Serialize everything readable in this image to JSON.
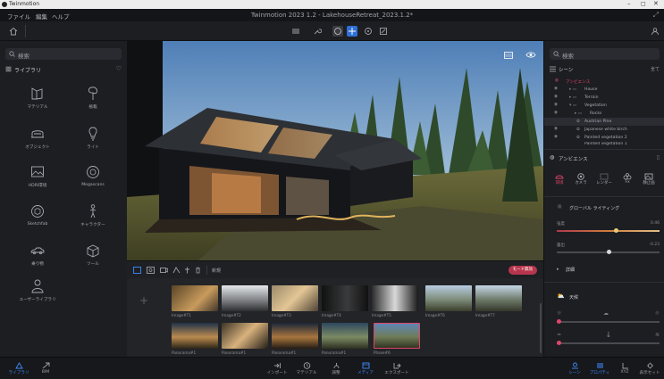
{
  "window": {
    "os_title": "Twinmotion",
    "app_title": "Twinmotion 2023 1.2 - LakehouseRetreat_2023.1.2*"
  },
  "menu": [
    "ファイル",
    "編集",
    "ヘルプ"
  ],
  "library": {
    "search_placeholder": "検索",
    "title": "ライブラリ",
    "items": [
      {
        "label": "マテリアル",
        "icon": "material-icon"
      },
      {
        "label": "植栽",
        "icon": "tree-icon"
      },
      {
        "label": "オブジェクト",
        "icon": "sofa-icon"
      },
      {
        "label": "ライト",
        "icon": "bulb-icon"
      },
      {
        "label": "HDRI環境",
        "icon": "hdri-icon"
      },
      {
        "label": "Megascans",
        "icon": "megascans-icon"
      },
      {
        "label": "Sketchfab",
        "icon": "sketchfab-icon"
      },
      {
        "label": "キャラクター",
        "icon": "character-icon"
      },
      {
        "label": "乗り物",
        "icon": "car-icon"
      },
      {
        "label": "ツール",
        "icon": "tools-icon"
      },
      {
        "label": "ユーザーライブラリ",
        "icon": "user-library-icon"
      }
    ]
  },
  "media": {
    "new_label": "新規",
    "mode_button": "モード無効",
    "row1": [
      "Image#T1",
      "Image#T2",
      "Image#T3",
      "Image#T4",
      "Image#T5",
      "Image#T6",
      "Image#T7"
    ],
    "row2": [
      "Panorama#1",
      "Panorama#1",
      "Panorama#1",
      "Panorama#1",
      "Phase#6"
    ]
  },
  "scene": {
    "search_placeholder": "検索",
    "title": "シーン",
    "filter": "全て",
    "tree": [
      {
        "label": "アンビエンス",
        "level": 0,
        "highlight": true
      },
      {
        "label": "House",
        "level": 1
      },
      {
        "label": "Terrain",
        "level": 1
      },
      {
        "label": "Vegetation",
        "level": 1
      },
      {
        "label": "Rocks",
        "level": 2
      },
      {
        "label": "Austrian Pine",
        "level": 2,
        "selected": true
      },
      {
        "label": "Japanese white birch",
        "level": 2
      },
      {
        "label": "Painted vegetation 2",
        "level": 2
      },
      {
        "label": "Painted vegetation 1",
        "level": 2
      }
    ]
  },
  "properties": {
    "title": "アンビエンス",
    "tabs": [
      {
        "label": "環境",
        "active": true
      },
      {
        "label": "カメラ"
      },
      {
        "label": "レンダー"
      },
      {
        "label": "Fx"
      },
      {
        "label": "静止画"
      }
    ],
    "global_lighting": "グローバル ライティング",
    "sliders": [
      {
        "label": "強度",
        "value": "0.46"
      },
      {
        "label": "露出",
        "value": "-0.23"
      }
    ],
    "detail": "詳細",
    "weather": "天候"
  },
  "bottombar": {
    "left": [
      {
        "label": "ライブラリ",
        "active": true
      },
      {
        "label": "BIM"
      }
    ],
    "center": [
      {
        "label": "インポート"
      },
      {
        "label": "マテリアル"
      },
      {
        "label": "調整"
      },
      {
        "label": "メディア",
        "active": true
      },
      {
        "label": "エクスポート"
      }
    ],
    "right": [
      {
        "label": "シーン",
        "active": true
      },
      {
        "label": "プロパティ",
        "active": true
      },
      {
        "label": "XYZ"
      },
      {
        "label": "表示セット"
      }
    ]
  },
  "colors": {
    "accent": "#3d8bff",
    "highlight": "#e0466a",
    "panel": "#1d1e22"
  }
}
